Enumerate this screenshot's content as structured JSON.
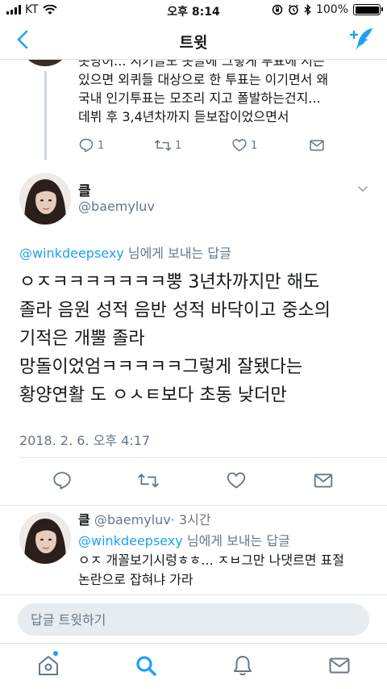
{
  "status_bar": {
    "carrier": "KT",
    "time": "오후 8:14",
    "battery": "100%"
  },
  "nav": {
    "title": "트윗"
  },
  "previous_tweet": {
    "lines": [
      "옷냥어... 지기글도 옷글에 그렇게 투표에 저는",
      "있으면 외퀴들 대상으로 한 투표는 이기면서 왜",
      "국내 인기투표는 모조리 지고 폴발하는건지...",
      "데뷔 후 3,4년차까지 듣보잡이었으면서"
    ],
    "reply_count": "1",
    "retweet_count": "1",
    "like_count": "1"
  },
  "main_tweet": {
    "name": "클",
    "handle": "@baemyluv",
    "reply_to_mention": "@winkdeepsexy",
    "reply_to_suffix": " 님에게 보내는 답글",
    "lines": [
      "ㅇㅈㅋㅋㅋㅋㅋㅋㅋ뿡 3년차까지만 해도",
      "졸라 음원 성적 음반 성적 바닥이고 중소의",
      "기적은 개뿔 졸라",
      "망돌이었엄ㅋㅋㅋㅋㅋ그렇게 잘됐다는",
      "황양연활 도 ㅇㅅㅌ보다 초동 낮더만"
    ],
    "timestamp": "2018. 2. 6. 오후 4:17"
  },
  "reply_tweet": {
    "name": "클",
    "handle": "@baemyluv",
    "time": "· 3시간",
    "reply_to_mention": "@winkdeepsexy",
    "reply_to_suffix": " 님에게 보내는 답글",
    "lines": [
      "ㅇㅈ 개꼴보기시렁ㅎㅎ... ㅈㅂ그만 나댓르면 표절",
      "논란으로 잡혀냐 가라"
    ]
  },
  "reply_bar": {
    "placeholder": "답글 트윗하기"
  },
  "colors": {
    "accent": "#1da1f2",
    "muted": "#657786",
    "text": "#14171a",
    "divider": "#e1e8ed"
  }
}
